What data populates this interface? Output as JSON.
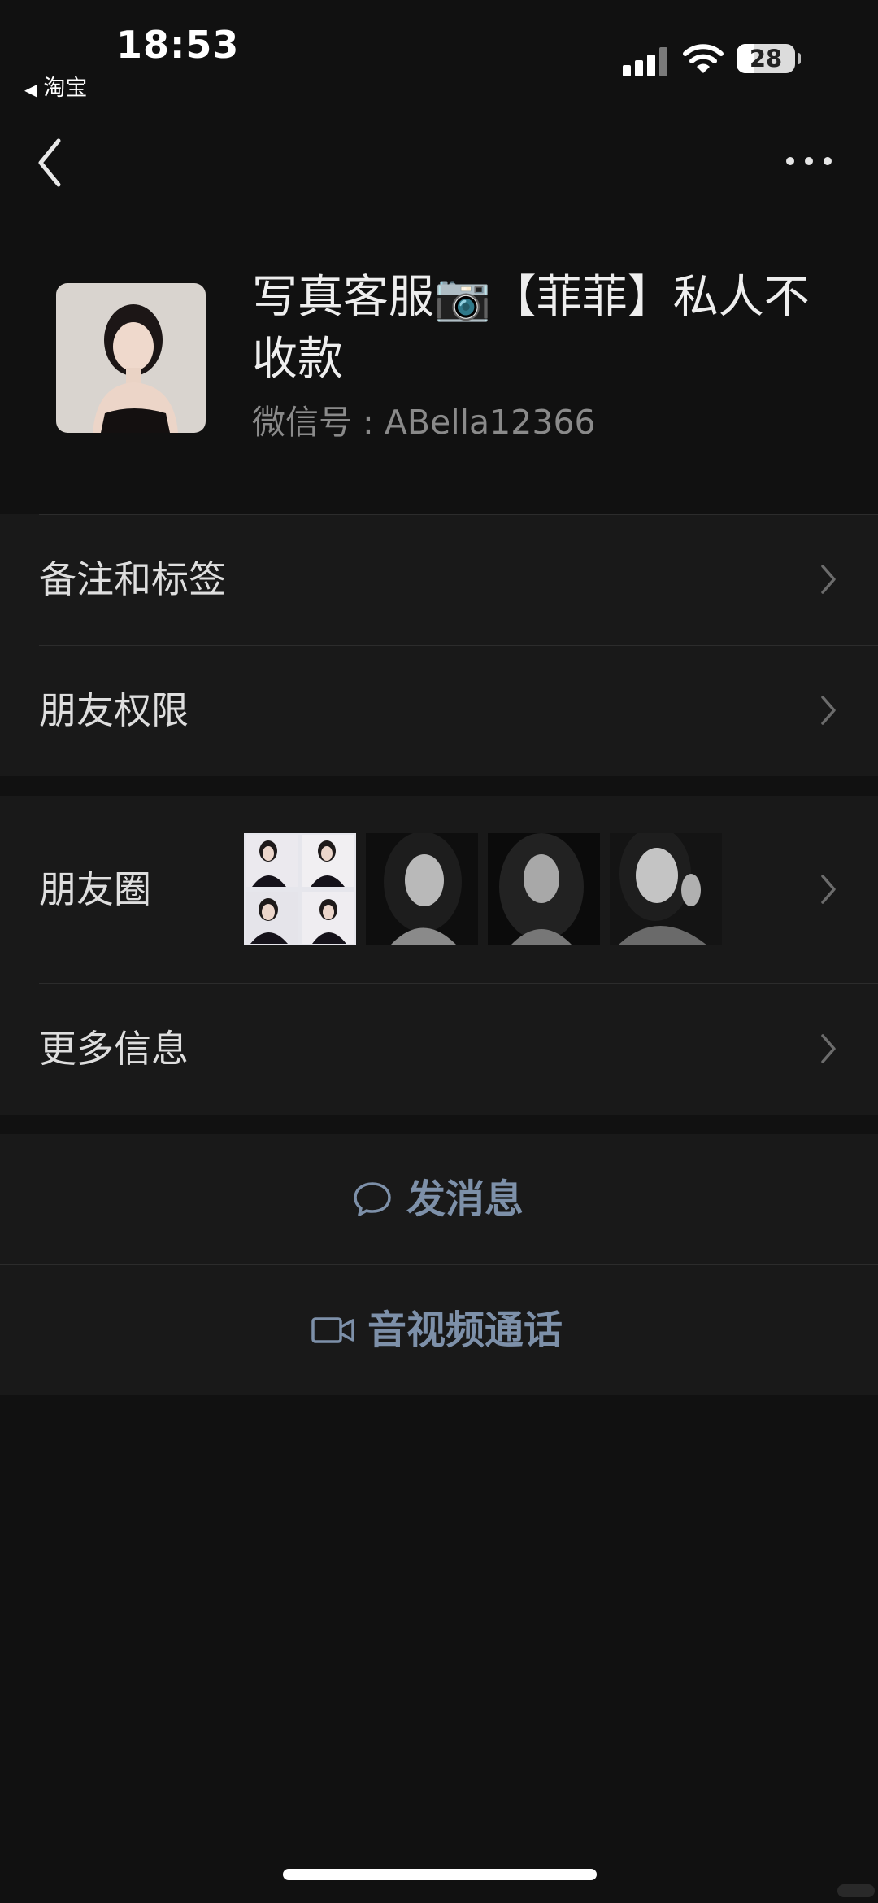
{
  "status_bar": {
    "time": "18:53",
    "back_app": "淘宝",
    "battery": "28"
  },
  "profile": {
    "name": "写真客服📷【菲菲】私人不收款",
    "wechat_id": "微信号 : ABella12366"
  },
  "menu_group_1": [
    {
      "label": "备注和标签"
    },
    {
      "label": "朋友权限"
    }
  ],
  "menu_group_2": [
    {
      "label": "朋友圈"
    },
    {
      "label": "更多信息"
    }
  ],
  "actions": {
    "message": "发消息",
    "video_call": "音视频通话"
  },
  "colors": {
    "background": "#111111",
    "card": "#191919",
    "action_text": "#7d90a9"
  }
}
